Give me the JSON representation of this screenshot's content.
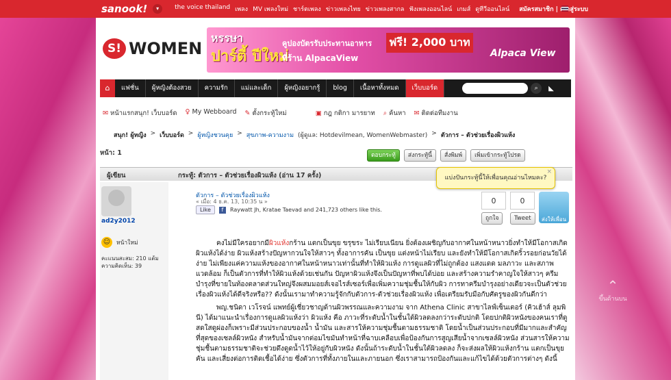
{
  "topbar": {
    "logo": "sanook!",
    "menu": [
      "the voice thailand",
      "เพลง",
      "MV เพลงใหม่",
      "ชาร์ตเพลง",
      "ข่าวเพลงไทย",
      "ข่าวเพลงสากล",
      "ฟังเพลงออนไลน์",
      "เกมส์",
      "ดูทีวีออนไลน์"
    ],
    "account": "สมัครสมาชิก | เข้าสู่ระบบ"
  },
  "brand": {
    "mark": "S!",
    "name": "WOMEN"
  },
  "banner": {
    "line1": "หรรษา",
    "line2": "ปาร์ตี้ ปีใหม่",
    "line3": "คูปองบัตรรับประทานอาหาร",
    "promo": "ฟรี! 2,000 บาท",
    "line4": "ที่ร้าน AlpacaView",
    "line5": "Alpaca View"
  },
  "nav": {
    "items": [
      "แฟชั่น",
      "ผู้หญิงต้องสวย",
      "ความรัก",
      "แม่และเด็ก",
      "ผู้หญิงอยากรู้",
      "blog",
      "เนื้อหาทั้งหมด",
      "เว็บบอร์ด"
    ]
  },
  "subbar": [
    "หน้าแรกสนุก! เว็บบอร์ด",
    "My Webboard",
    "ตั้งกระทู้ใหม่",
    "กฎ กติกา มารยาท",
    "ค้นหา",
    "ติดต่อทีมงาน"
  ],
  "breadcrumb": [
    "สนุก! ผู้หญิง",
    ">",
    "เว็บบอร์ด",
    ">",
    "ผู้หญิงชวนคุย",
    ">",
    "สุขภาพ-ความงาม",
    "(ผู้ดูแล: Hotdevilmean, WomenWebmaster)",
    ">",
    "ตัวการ – ตัวช่วยเรื่องผิวแห้ง"
  ],
  "page_label": "หน้า: 1",
  "buttons": [
    "ตอบกระทู้",
    "ส่งกระทู้นี้",
    "สั่งพิมพ์",
    "เพิ่มเข้ากระทู้โปรด"
  ],
  "post_header": {
    "author_label": "ผู้เขียน",
    "topic": "กระทู้: ตัวการ – ตัวช่วยเรื่องผิวแห้ง  (อ่าน 17 ครั้ง)"
  },
  "author": {
    "name": "ad2y2012",
    "mood": "หน้าใหม่",
    "points": "คะแนนสะสม: 210 แต้ม",
    "comments": "ความคิดเห็น: 39"
  },
  "post": {
    "title": "ตัวการ – ตัวช่วยเรื่องผิวแห้ง",
    "date": "« เมื่อ: 4 ธ.ค. 13, 10:35 น »",
    "like_button": "Like",
    "like_text": "Raywatt Jh, Kratae Taevad and 241,723 others like this."
  },
  "share": {
    "count_a": "0",
    "count_b": "0",
    "fb_label": "ถูกใจ",
    "tweet_label": "Tweet",
    "big_label": "ส่งให้เพื่อน"
  },
  "popup": {
    "text": "แบ่งปันกระทู้นี้ให้เพื่อนคุณอ่านไหมคะ?",
    "close": "×"
  },
  "body": {
    "p1_pre": "คงไม่มีใครอยากมี",
    "p1_hl": "ผิวแห้ง",
    "p1_post": "กร้าน แตกเป็นขุย ขรุขระ ไม่เรียบเนียน ยิ่งต้องเผชิญกับอากาศในหน้าหนาวยิ่งทำให้มีโอกาสเกิดผิวแห้งได้ง่าย ผิวแห้งสร้างปัญหากวนใจให้สาวๆ ทั้งอาการคัน เป็นขุย แต่งหน้าไม่เรียบ และยังทำให้มีโอกาสเกิดริ้วรอยก่อนวัยได้ง่าย ไม่เพียงแค่ความแห้งของอากาศในหน้าหนาวเท่านั้นที่ทำให้ผิวแห้ง การดูแลผิวที่ไม่ถูกต้อง แสงแดด มลภาวะ และสภาพแวดล้อม ก็เป็นตัวการที่ทำให้ผิวแห้งด้วยเช่นกัน ปัญหาผิวแห้งจึงเป็นปัญหาที่พบได้บ่อย และสร้างความรำคาญใจให้สาวๆ ครีมบำรุงที่ขายในท้องตลาดส่วนใหญ่จึงผสมมอยส์เจอไรส์เซอร์เพื่อเพิ่มความชุ่มชื้นให้กับผิว การทาครีมบำรุงอย่างเดียวจะเป็นตัวช่วยเรื่องผิวแห้งได้ดีจริงหรือ?? ดังนั้นเรามาทำความรู้จักกับตัวการ-ตัวช่วยเรื่องผิวแห้ง เพื่อเตรียมรับมือกับศัตรูของผิวกันดีกว่า",
    "p2": "พญ.ชนิดา เวโรจน์ แพทย์ผู้เชี่ยวชาญด้านผิวพรรณและความงาม จาก Athena Clinic สาขาไลฟ์เซ็นเตอร์ (คิวเฮ้าส์ ลุมพินี) ได้มาแนะนำเรื่องการดูแลผิวแห้งว่า ผิวแห้ง คือ ภาวะที่ระดับน้ำในชั้นใต้ผิวลดลงกว่าระดับปกติ โดยปกติผิวหนังของคนเราที่ดูสดใสดูผ่องก็เพราะมีส่วนประกอบของน้ำ น้ำมัน และสารให้ความชุ่มชื้นตามธรรมชาติ โดยน้ำเป็นส่วนประกอบที่มีมากและสำคัญที่สุดของเซลล์ผิวหนัง สำหรับน้ำมันจากต่อมไขมันทำหน้าที่ฉาบเคลือบเพื่อป้องกันการสูญเสียน้ำจากเซลล์ผิวหนัง ส่วนสารให้ความชุ่มชื้นตามธรรมชาติจะช่วยดึงดูดน้ำไว้ให้อยู่กับผิวหนัง ดังนั้นถ้าระดับน้ำในชั้นใต้ผิวลดลง ก็จะส่งผลให้ผิวแห้งกร้าน แตกเป็นขุย คัน และเสี่ยงต่อการติดเชื้อได้ง่าย ซึ่งตัวการที่ทั้งภายในและภายนอก ซึ่งเราสามารถป้องกันและแก้ไขได้ด้วยตัวการต่างๆ ดังนี้"
  },
  "scroll_top": "ขึ้นด้านบน"
}
